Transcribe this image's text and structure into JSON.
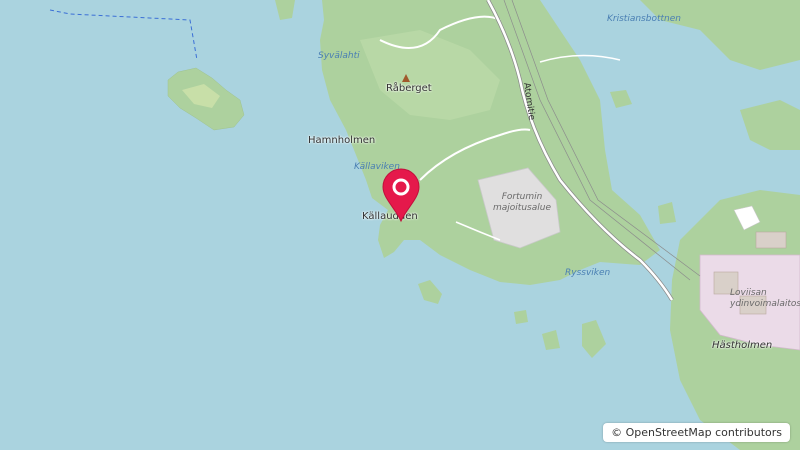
{
  "map": {
    "colors": {
      "water": "#aad3df",
      "forest": "#add19e",
      "forest_light": "#c8dfa8",
      "industrial": "#ebdbe8",
      "residential": "#e0dfdf",
      "marker": "#e5194b"
    },
    "labels": {
      "syvalahti": "Syvälahti",
      "raberget": "Råberget",
      "hamnholmen": "Hamnholmen",
      "kallaviken": "Källaviken",
      "kallaudden": "Källaudden",
      "atomitie": "Atomitie",
      "fortum_line1": "Fortumin",
      "fortum_line2": "majoitusalue",
      "ryssviken": "Ryssviken",
      "kristiansbottnen": "Kristiansbottnen",
      "loviisa_line1": "Loviisan",
      "loviisa_line2": "ydinvoimalaitos",
      "hastholmen": "Hästholmen"
    },
    "icons": {
      "peak": "peak-icon",
      "marker": "location-marker-icon"
    }
  },
  "attribution": {
    "symbol": "©",
    "text": "OpenStreetMap contributors"
  }
}
